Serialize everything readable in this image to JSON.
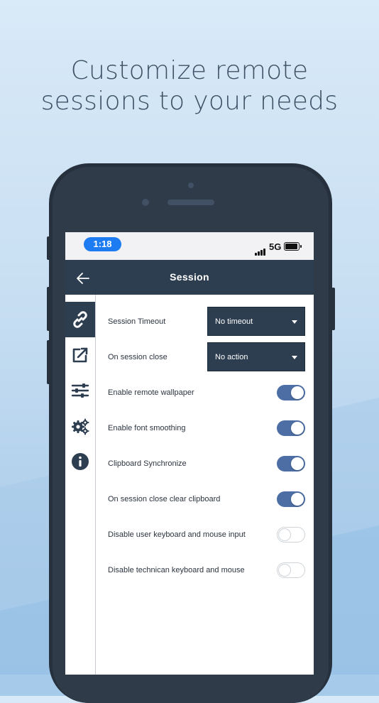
{
  "promo": {
    "headline_line1": "Customize remote",
    "headline_line2": "sessions to your needs"
  },
  "status_bar": {
    "time": "1:18",
    "network": "5G"
  },
  "app_bar": {
    "title": "Session"
  },
  "sidebar": {
    "items": [
      {
        "icon": "link-icon",
        "active": true
      },
      {
        "icon": "external-link-icon",
        "active": false
      },
      {
        "icon": "sliders-icon",
        "active": false
      },
      {
        "icon": "gears-icon",
        "active": false
      },
      {
        "icon": "info-icon",
        "active": false
      }
    ]
  },
  "settings": {
    "session_timeout": {
      "label": "Session Timeout",
      "value": "No timeout"
    },
    "on_session_close": {
      "label": "On session close",
      "value": "No action"
    },
    "toggles": [
      {
        "label": "Enable remote wallpaper",
        "on": true
      },
      {
        "label": "Enable font smoothing",
        "on": true
      },
      {
        "label": "Clipboard Synchronize",
        "on": true
      },
      {
        "label": "On session close clear clipboard",
        "on": true
      },
      {
        "label": "Disable user keyboard and mouse input",
        "on": false
      },
      {
        "label": "Disable technican keyboard and mouse",
        "on": false
      }
    ]
  },
  "colors": {
    "app_bar": "#2d3e50",
    "toggle_on": "#4c6ea5",
    "time_pill": "#1e7cf2"
  }
}
